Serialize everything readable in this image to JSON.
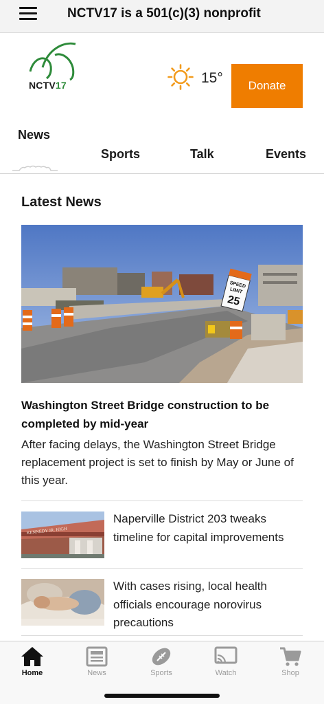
{
  "topbar": {
    "menu_icon": "hamburger-menu-icon",
    "title": "NCTV17 is a 501(c)(3) nonprofit"
  },
  "header": {
    "logo_text_main": "NCTV",
    "logo_text_accent": "17",
    "weather_icon": "sun-icon",
    "temperature": "15°",
    "donate_label": "Donate",
    "accent_color": "#ef7d00",
    "logo_color": "#2e8b3a"
  },
  "tabs": [
    {
      "label": "News",
      "selected": true
    },
    {
      "label": "Sports",
      "selected": false
    },
    {
      "label": "Talk",
      "selected": false
    },
    {
      "label": "Events",
      "selected": false
    }
  ],
  "main": {
    "section_title": "Latest News",
    "hero": {
      "headline": "Washington Street Bridge construction to be completed by mid-year",
      "summary": "After facing delays, the Washington Street Bridge replacement project is set to finish by May or June of this year.",
      "image_sign_text": [
        "SPEED",
        "LIMIT",
        "25"
      ]
    },
    "articles": [
      {
        "title": "Naperville District 203 tweaks timeline for capital improvements",
        "thumb_sign_text": "KENNEDY JR. HIGH"
      },
      {
        "title": "With cases rising, local health officials encourage norovirus precautions"
      }
    ]
  },
  "bottom_nav": [
    {
      "label": "Home",
      "icon": "home-icon",
      "active": true
    },
    {
      "label": "News",
      "icon": "newspaper-icon",
      "active": false
    },
    {
      "label": "Sports",
      "icon": "football-icon",
      "active": false
    },
    {
      "label": "Watch",
      "icon": "tv-cast-icon",
      "active": false
    },
    {
      "label": "Shop",
      "icon": "shopping-cart-icon",
      "active": false
    }
  ]
}
